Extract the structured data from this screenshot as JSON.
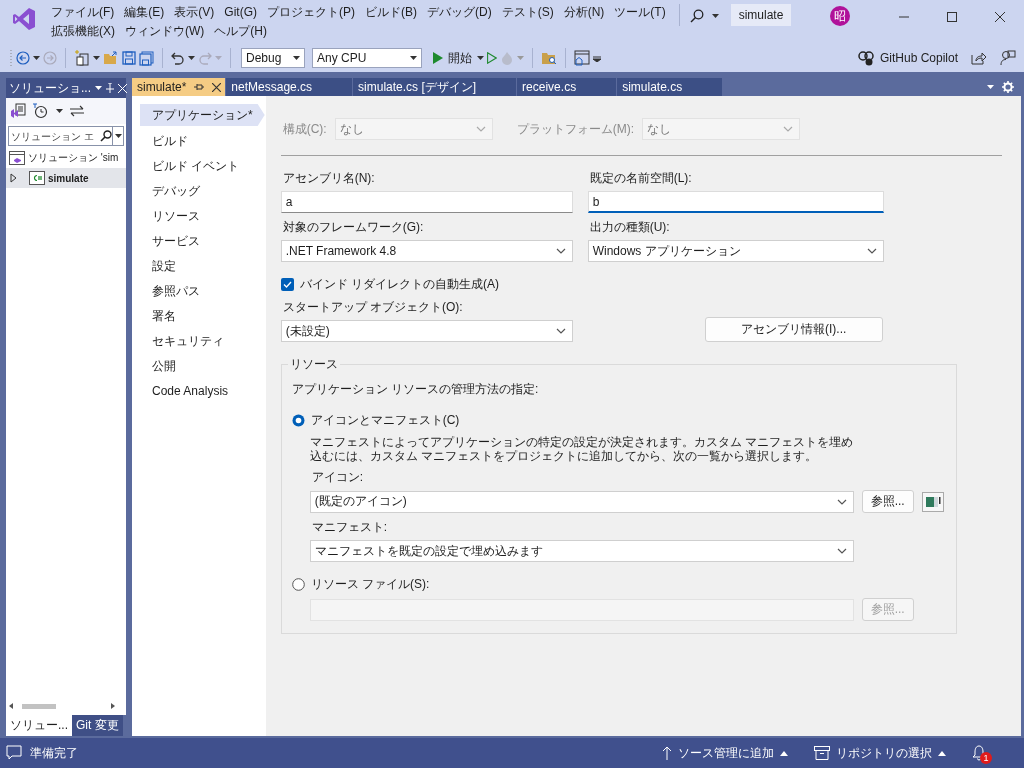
{
  "window": {
    "title": "simulate",
    "avatar": "昭"
  },
  "menu_rows": [
    [
      "ファイル(F)",
      "編集(E)",
      "表示(V)",
      "Git(G)",
      "プロジェクト(P)",
      "ビルド(B)",
      "デバッグ(D)",
      "テスト(S)",
      "分析(N)",
      "ツール(T)"
    ],
    [
      "拡張機能(X)",
      "ウィンドウ(W)",
      "ヘルプ(H)"
    ]
  ],
  "toolbar": {
    "configuration": "Debug",
    "platform": "Any CPU",
    "start": "開始",
    "copilot": "GitHub Copilot"
  },
  "solution_explorer": {
    "title": "ソリューショ...",
    "search": {
      "placeholder": "ソリューション エ"
    },
    "tree": [
      {
        "label": "ソリューション 'sim",
        "kind": "solution",
        "selected": false,
        "children": [
          {
            "label": "simulate",
            "kind": "project",
            "selected": true,
            "expanded": false
          }
        ]
      }
    ],
    "tabs": [
      {
        "label": "ソリュー...",
        "selected": true
      },
      {
        "label": "Git 変更",
        "selected": false
      }
    ]
  },
  "document_tabs": [
    {
      "label": "simulate*",
      "selected": true
    },
    {
      "label": "netMessage.cs",
      "selected": false
    },
    {
      "label": "simulate.cs [デザイン]",
      "selected": false
    },
    {
      "label": "receive.cs",
      "selected": false
    },
    {
      "label": "simulate.cs",
      "selected": false
    }
  ],
  "property_nav": [
    {
      "label": "アプリケーション*",
      "selected": true
    },
    {
      "label": "ビルド",
      "selected": false
    },
    {
      "label": "ビルド イベント",
      "selected": false
    },
    {
      "label": "デバッグ",
      "selected": false
    },
    {
      "label": "リソース",
      "selected": false
    },
    {
      "label": "サービス",
      "selected": false
    },
    {
      "label": "設定",
      "selected": false
    },
    {
      "label": "参照パス",
      "selected": false
    },
    {
      "label": "署名",
      "selected": false
    },
    {
      "label": "セキュリティ",
      "selected": false
    },
    {
      "label": "公開",
      "selected": false
    },
    {
      "label": "Code Analysis",
      "selected": false
    }
  ],
  "config": [
    {
      "label": "構成(C):",
      "value": "なし",
      "disabled": true
    },
    {
      "label": "プラットフォーム(M):",
      "value": "なし",
      "disabled": true
    }
  ],
  "fields": [
    {
      "label": "アセンブリ名(N):",
      "kind": "text",
      "value": "a",
      "focused": false
    },
    {
      "label": "既定の名前空間(L):",
      "kind": "text",
      "value": "b",
      "focused": true
    },
    {
      "label": "対象のフレームワーク(G):",
      "kind": "select",
      "value": ".NET Framework 4.8"
    },
    {
      "label": "出力の種類(U):",
      "kind": "select",
      "value": "Windows アプリケーション"
    }
  ],
  "binding_redirect": {
    "label": "バインド リダイレクトの自動生成(A)",
    "checked": true
  },
  "startup": {
    "label": "スタートアップ オブジェクト(O):",
    "value": "(未設定)"
  },
  "assembly_info_button": "アセンブリ情報(I)...",
  "resources": {
    "title": "リソース",
    "description": "アプリケーション リソースの管理方法の指定:",
    "options": [
      {
        "label": "アイコンとマニフェスト(C)",
        "selected": true
      },
      {
        "label": "リソース ファイル(S):",
        "selected": false
      }
    ],
    "manifest_note": "マニフェストによってアプリケーションの特定の設定が決定されます。カスタム マニフェストを埋め込むには、カスタム マニフェストをプロジェクトに追加してから、次の一覧から選択します。",
    "icon": {
      "label": "アイコン:",
      "value": "(既定のアイコン)",
      "browse": "参照..."
    },
    "manifest": {
      "label": "マニフェスト:",
      "value": "マニフェストを既定の設定で埋め込みます"
    },
    "resource_file": {
      "browse": "参照...",
      "disabled": true
    }
  },
  "status_bar": {
    "message": "準備完了",
    "source_control": "ソース管理に追加",
    "repository": "リポジトリの選択",
    "notifications": "1"
  }
}
